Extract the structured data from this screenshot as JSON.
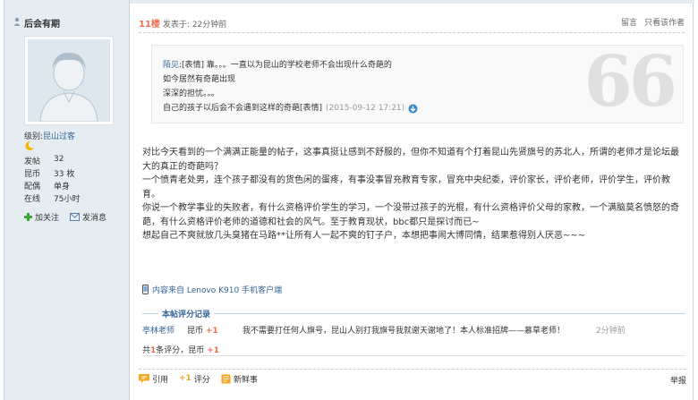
{
  "user": {
    "name": "后会有期",
    "level_label": "级别:",
    "level_value": "昆山过客",
    "stats": [
      {
        "key": "发帖",
        "value": "32"
      },
      {
        "key": "昆币",
        "value": "33 枚"
      },
      {
        "key": "配偶",
        "value": "单身"
      },
      {
        "key": "在线",
        "value": "75小时"
      }
    ],
    "actions": {
      "follow": "加关注",
      "message": "发消息"
    }
  },
  "post": {
    "floor": "11楼",
    "time": "发表于: 22分钟前",
    "reply_label": "留言",
    "only_author_label": "只看该作者",
    "quote": {
      "author": "陌见",
      "line1_rest": ":[表情] 靠。。。一直以为昆山的学校老师不会出现什么奇葩的",
      "line2": "如今居然有奇葩出现",
      "line3": "深深的担忧。。。",
      "line4": "自己的孩子以后会不会遇到这样的奇葩[表情]",
      "date": "(2015-09-12 17:21)",
      "mark": "66"
    },
    "body": [
      "对比今天看到的一个满满正能量的帖子，这事真挺让感到不舒服的，但你不知道有个打着昆山先贤旗号的苏北人，所谓的老师才是论坛最大的真正的奇葩吗？",
      "一个愤青老处男，连个孩子都没有的货色闲的蛋疼，有事没事冒充教育专家，冒充中央纪委，评价家长，评价老师，评价学生，评价教育。",
      "你说一个教学事业的失败者，有什么资格评价学生的学习，一个没带过孩子的光棍，有什么资格评价父母的家教，一个满脑莫名愤怒的奇葩，有什么资格评价老师的道德和社会的风气。至于教育现状，bbc都只是探讨而已~",
      "想起自己不爽就放几头臭猪在马路**让所有人一起不爽的钉子户，本想把事闹大博同情，结果惹得别人厌恶~~~"
    ],
    "client": "内容来自 Lenovo K910 手机客户端"
  },
  "rating": {
    "title": "本帖评分记录",
    "rows": [
      {
        "user": "亭林老师",
        "currency": "昆币",
        "amount": "+1",
        "reason": "我不需要打任何人旗号，昆山人别打我旗号我就谢天谢地了！本人标准招牌——慕草老师！",
        "time": "2分钟前"
      }
    ],
    "total_prefix": "共",
    "total_count": "1",
    "total_mid": "条评分，",
    "total_currency": "昆币",
    "total_amount": "+1"
  },
  "footer": {
    "quote": "引用",
    "rate_plus": "+1",
    "rate": "评分",
    "news": "新鲜事",
    "report": "举报"
  }
}
